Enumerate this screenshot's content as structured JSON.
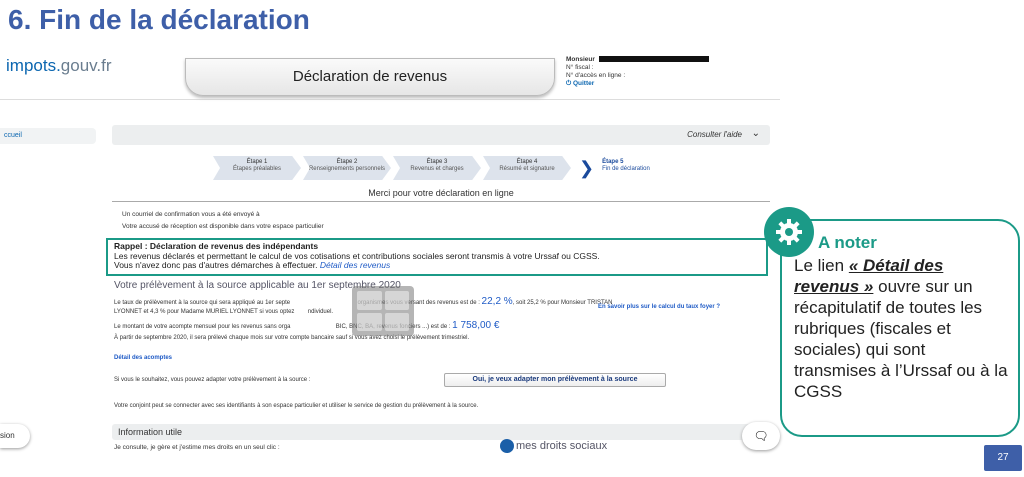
{
  "slide": {
    "title": "6. Fin de la déclaration",
    "page_number": "27"
  },
  "site": {
    "logo_main": "impots.",
    "logo_gouv": "gouv.fr",
    "header_title": "Déclaration de revenus"
  },
  "user": {
    "salutation": "Monsieur",
    "fiscal_label": "N° fiscal :",
    "access_label": "N° d'accès en ligne :",
    "quit_label": "Quitter"
  },
  "left_panel": {
    "item": "ccueil",
    "bottom_pill": "sion"
  },
  "help": {
    "label": "Consulter l'aide"
  },
  "steps": [
    {
      "title": "Étape 1",
      "sub": "Étapes préalables"
    },
    {
      "title": "Étape 2",
      "sub": "Renseignements personnels"
    },
    {
      "title": "Étape 3",
      "sub": "Revenus et charges"
    },
    {
      "title": "Étape 4",
      "sub": "Résumé et signature"
    },
    {
      "title": "Étape 5",
      "sub": "Fin de déclaration"
    }
  ],
  "confirmation": {
    "merci": "Merci pour votre déclaration en ligne",
    "line1": "Un courriel de confirmation vous a été envoyé à",
    "line2": "Votre accusé de réception est disponible dans votre espace particulier"
  },
  "rappel": {
    "title": "Rappel : Déclaration de revenus des indépendants",
    "body1": "Les revenus déclarés et permettant le calcul de vos cotisations et contributions sociales seront transmis à votre Urssaf ou CGSS.",
    "body2": "Vous n'avez donc pas d'autres démarches à effectuer.",
    "link": "Détail des revenus"
  },
  "prelevement": {
    "title": "Votre prélèvement à la source applicable au 1er septembre 2020",
    "taux_text_a": "Le taux de prélèvement à la source qui sera appliqué au 1er septe",
    "taux_text_b": "organismes vous versant des revenus est de :",
    "taux_value": "22,2 %",
    "taux_after": ", soit 25,2 % pour Monsieur TRISTAN",
    "taux_line2": "LYONNET et 4,3 % pour Madame MURIEL LYONNET si vous optez",
    "taux_line2_end": "ndividuel.",
    "savoir_plus": "En savoir plus sur le calcul du taux foyer ?",
    "acompte_text": "Le montant de votre acompte mensuel pour les revenus sans orga",
    "acompte_mid": "BIC, BNC, BA, revenus fonciers ...) est de :",
    "acompte_value": "1 758,00 €",
    "acompte_line2": "À partir de septembre 2020, il sera prélevé chaque mois sur votre compte bancaire sauf si vous avez choisi le prélèvement trimestriel.",
    "detail_acomptes": "Détail des acomptes",
    "adapt_prompt": "Si vous le souhaitez, vous pouvez adapter votre prélèvement à la source :",
    "adapt_button": "Oui, je veux adapter mon prélèvement à la source",
    "conjoint": "Votre conjoint peut se connecter avec ses identifiants à son espace particulier et utiliser le service de gestion du prélèvement à la source."
  },
  "info": {
    "title": "Information utile",
    "line": "Je consulte, je gère et j'estime mes droits en un seul clic :",
    "brand": "mes droits sociaux"
  },
  "note": {
    "title": "A noter",
    "intro": "Le lien ",
    "link": "« Détail des revenus »",
    "rest": " ouvre sur un récapitulatif de toutes les rubriques (fiscales et sociales) qui sont transmises à l’Urssaf ou à la CGSS"
  },
  "colors": {
    "title_blue": "#3e5fa8",
    "teal": "#1b9a87",
    "link_blue": "#1f5bc6"
  }
}
